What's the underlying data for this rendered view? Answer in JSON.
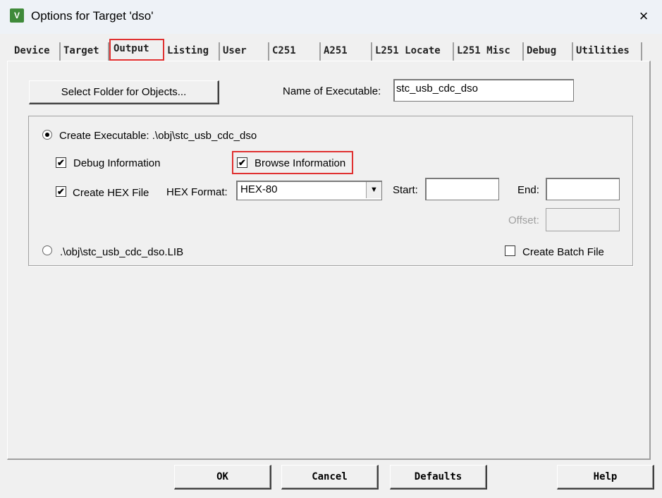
{
  "window": {
    "title": "Options for Target 'dso'",
    "close_icon": "×"
  },
  "tabs": [
    "Device",
    "Target",
    "Output",
    "Listing",
    "User",
    "C251",
    "A251",
    "L251 Locate",
    "L251 Misc",
    "Debug",
    "Utilities"
  ],
  "selected_tab": "Output",
  "highlight_color": "#e03030",
  "output": {
    "select_folder_label": "Select Folder for Objects...",
    "name_label": "Name of Executable:",
    "name_value": "stc_usb_cdc_dso",
    "create_exe_label": "Create Executable:  .\\obj\\stc_usb_cdc_dso",
    "create_exe_selected": true,
    "debug_info_label": "Debug Information",
    "debug_info_checked": true,
    "browse_info_label": "Browse Information",
    "browse_info_checked": true,
    "hex_label": "Create HEX File",
    "hex_checked": true,
    "hex_format_label": "HEX Format:",
    "hex_format_value": "HEX-80",
    "start_label": "Start:",
    "end_label": "End:",
    "offset_label": "Offset:",
    "lib_label": ".\\obj\\stc_usb_cdc_dso.LIB",
    "batch_label": "Create Batch File",
    "batch_checked": false
  },
  "buttons": {
    "ok": "OK",
    "cancel": "Cancel",
    "defaults": "Defaults",
    "help": "Help"
  }
}
